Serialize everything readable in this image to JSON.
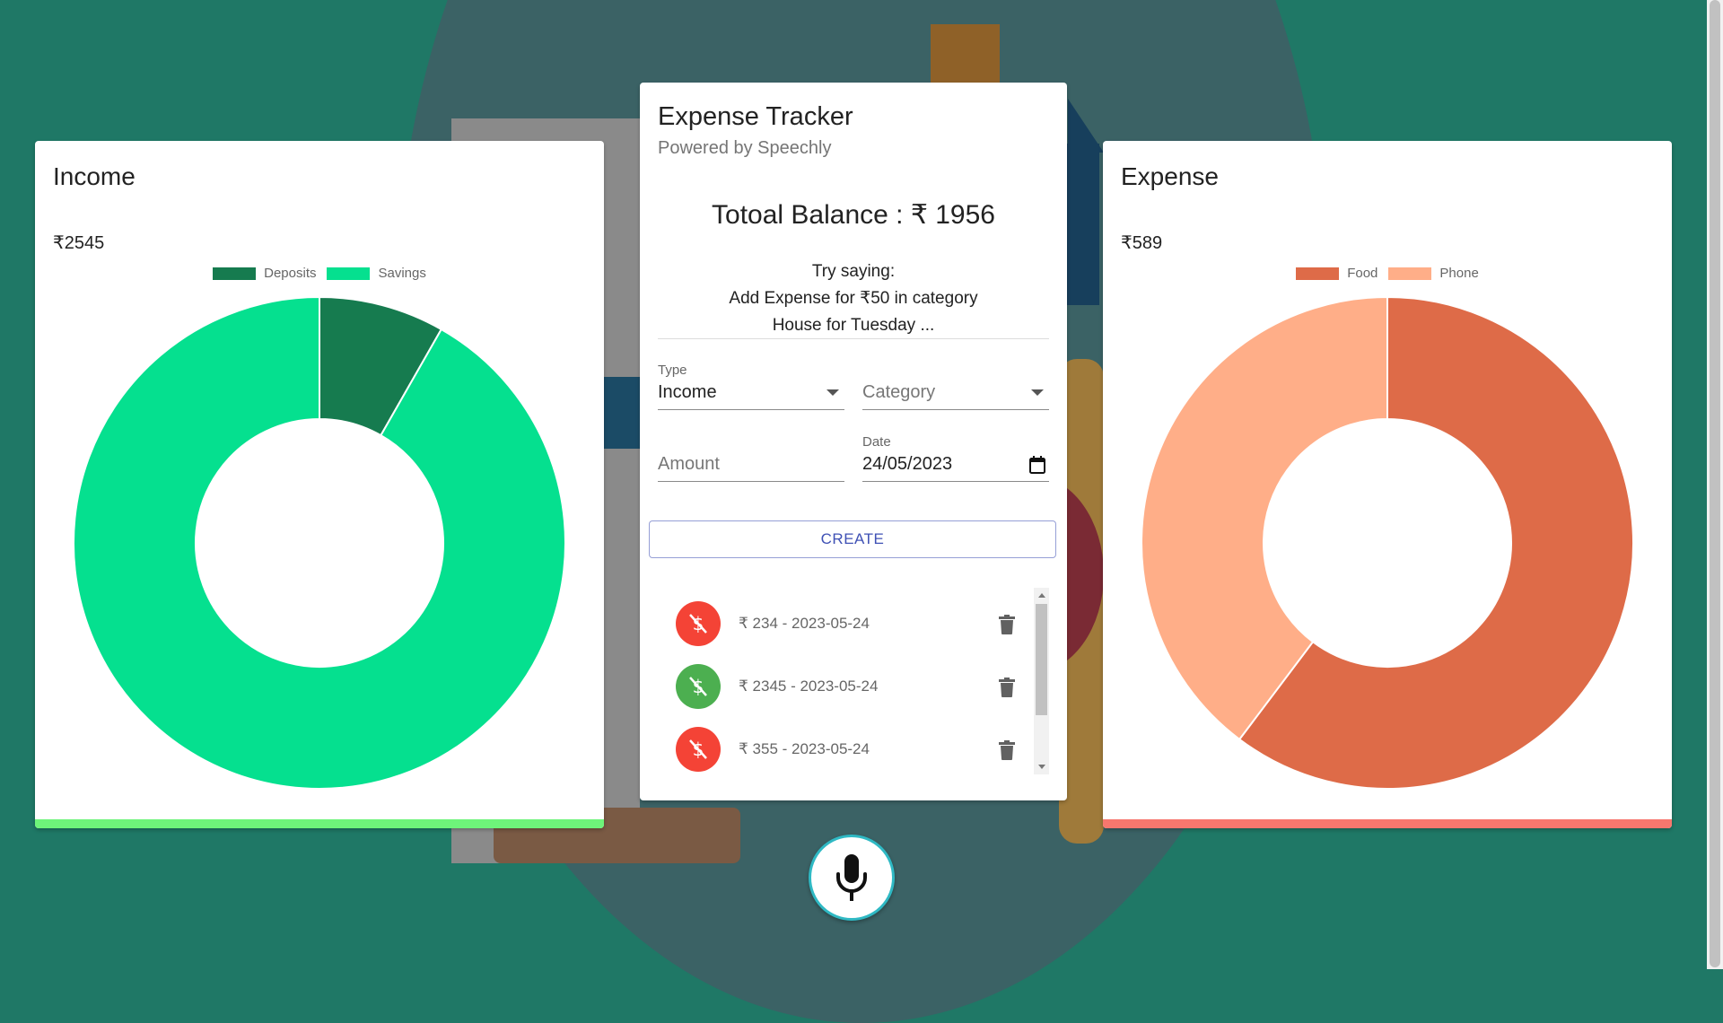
{
  "colors": {
    "page_bg": "#1f7866",
    "income_accent": "#6ef47a",
    "expense_accent": "#f7776e",
    "button_primary": "#3f51b5",
    "expense_icon": "#f44336",
    "income_icon": "#4caf50"
  },
  "income": {
    "title": "Income",
    "amount": "₹2545",
    "chart_data": {
      "type": "pie",
      "style": "doughnut",
      "categories": [
        "Deposits",
        "Savings"
      ],
      "values": [
        210,
        2335
      ],
      "colors": [
        "#167b4f",
        "#05e08f"
      ],
      "legend": "top"
    }
  },
  "expense": {
    "title": "Expense",
    "amount": "₹589",
    "chart_data": {
      "type": "pie",
      "style": "doughnut",
      "categories": [
        "Food",
        "Phone"
      ],
      "values": [
        355,
        234
      ],
      "colors": [
        "#de6b48",
        "#ffae88"
      ],
      "legend": "top"
    }
  },
  "tracker": {
    "title": "Expense Tracker",
    "subtitle": "Powered by Speechly",
    "balance": "Totoal Balance : ₹ 1956",
    "try_line1": "Try saying:",
    "try_line2": "Add Expense for ₹50 in category",
    "try_line3": "House for Tuesday ...",
    "type_label": "Type",
    "type_value": "Income",
    "category_placeholder": "Category",
    "amount_placeholder": "Amount",
    "date_label": "Date",
    "date_value": "24/05/2023",
    "create_label": "CREATE",
    "transactions": [
      {
        "text": "₹ 234 - 2023-05-24",
        "kind": "expense",
        "icon": "dollar-off-icon"
      },
      {
        "text": "₹ 2345 - 2023-05-24",
        "kind": "income",
        "icon": "dollar-off-icon"
      },
      {
        "text": "₹ 355 - 2023-05-24",
        "kind": "expense",
        "icon": "dollar-off-icon"
      }
    ]
  },
  "mic": {
    "icon": "microphone-icon"
  }
}
